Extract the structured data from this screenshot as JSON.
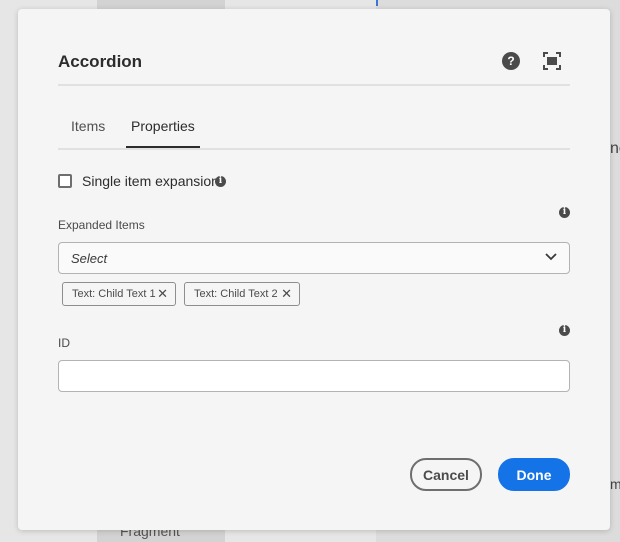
{
  "background": {
    "fragment_label": "Fragment",
    "right_edge_fragment_1": "ne",
    "right_edge_fragment_2": "m"
  },
  "dialog": {
    "title": "Accordion",
    "help_icon": "help-icon",
    "fullscreen_icon": "fullscreen-icon",
    "tabs": [
      {
        "label": "Items",
        "selected": false
      },
      {
        "label": "Properties",
        "selected": true
      }
    ],
    "single_item_expansion": {
      "label": "Single item expansion",
      "checked": false,
      "info_icon": "info-icon"
    },
    "expanded_items": {
      "label": "Expanded Items",
      "placeholder": "Select",
      "selected": [
        {
          "label": "Text: Child Text 1"
        },
        {
          "label": "Text: Child Text 2"
        }
      ]
    },
    "id_field": {
      "label": "ID",
      "value": ""
    },
    "buttons": {
      "cancel": "Cancel",
      "done": "Done"
    },
    "colors": {
      "accent": "#1473e6",
      "icon_dark": "#4b4b4b"
    }
  }
}
